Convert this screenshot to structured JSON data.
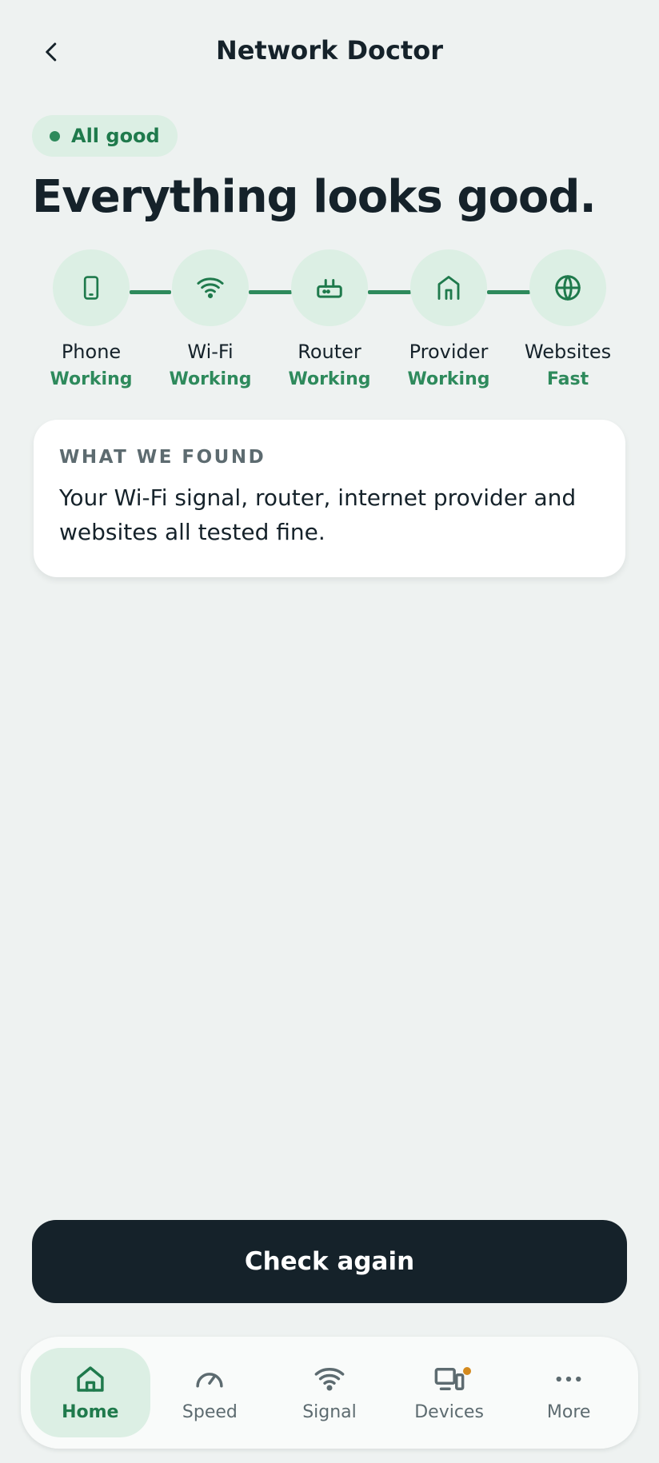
{
  "header": {
    "title": "Network Doctor",
    "back_icon": "chevron-left-icon"
  },
  "status": {
    "label": "All good",
    "color": "#2e8a5c"
  },
  "headline": "Everything looks good.",
  "chain": [
    {
      "name": "Phone",
      "state": "Working",
      "icon": "phone-icon"
    },
    {
      "name": "Wi-Fi",
      "state": "Working",
      "icon": "wifi-icon"
    },
    {
      "name": "Router",
      "state": "Working",
      "icon": "router-icon"
    },
    {
      "name": "Provider",
      "state": "Working",
      "icon": "building-icon"
    },
    {
      "name": "Websites",
      "state": "Fast",
      "icon": "globe-icon"
    }
  ],
  "found": {
    "heading": "WHAT WE FOUND",
    "body": "Your Wi-Fi signal, router, internet provider and websites all tested fine."
  },
  "actions": {
    "check_again": "Check again"
  },
  "nav": {
    "items": [
      {
        "label": "Home",
        "icon": "home-icon",
        "active": true
      },
      {
        "label": "Speed",
        "icon": "speedometer-icon",
        "active": false
      },
      {
        "label": "Signal",
        "icon": "wifi-icon",
        "active": false
      },
      {
        "label": "Devices",
        "icon": "devices-icon",
        "active": false,
        "badge": true
      },
      {
        "label": "More",
        "icon": "more-dots-icon",
        "active": false
      }
    ]
  },
  "colors": {
    "accent": "#2e8a5c",
    "accent_bg": "#dcefe4",
    "dark": "#15222a",
    "badge": "#d48a1e",
    "background": "#eef2f1"
  }
}
